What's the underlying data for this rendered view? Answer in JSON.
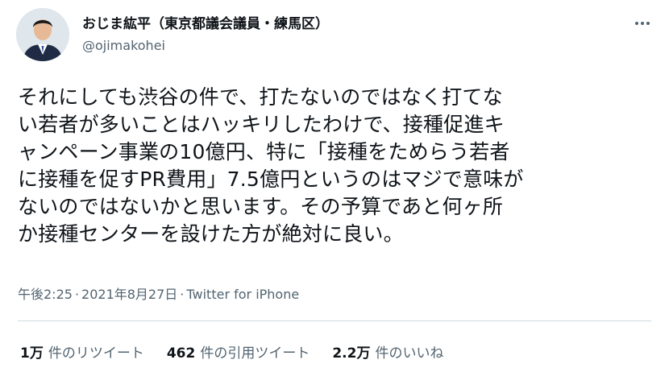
{
  "author": {
    "display_name": "おじま紘平（東京都議会議員・練馬区）",
    "handle": "@ojimakohei",
    "avatar_icon": "user-avatar-photo"
  },
  "tweet": {
    "lines": [
      "それにしても渋谷の件で、打たないのではなく打てな",
      "い若者が多いことはハッキリしたわけで、接種促進キ",
      "ャンペーン事業の10億円、特に「接種をためらう若者",
      "に接種を促すPR費用」7.5億円というのはマジで意味が",
      "ないのではないかと思います。その予算であと何ヶ所",
      "か接種センターを設けた方が絶対に良い。"
    ]
  },
  "meta": {
    "time": "午後2:25",
    "separator": "·",
    "date": "2021年8月27日",
    "source": "Twitter for iPhone"
  },
  "stats": {
    "retweets_count": "1万",
    "retweets_label": "件のリツイート",
    "quotes_count": "462",
    "quotes_label": "件の引用ツイート",
    "likes_count": "2.2万",
    "likes_label": "件のいいね"
  },
  "colors": {
    "text_primary": "#0f1419",
    "text_secondary": "#536471",
    "divider": "#cfd9de"
  }
}
